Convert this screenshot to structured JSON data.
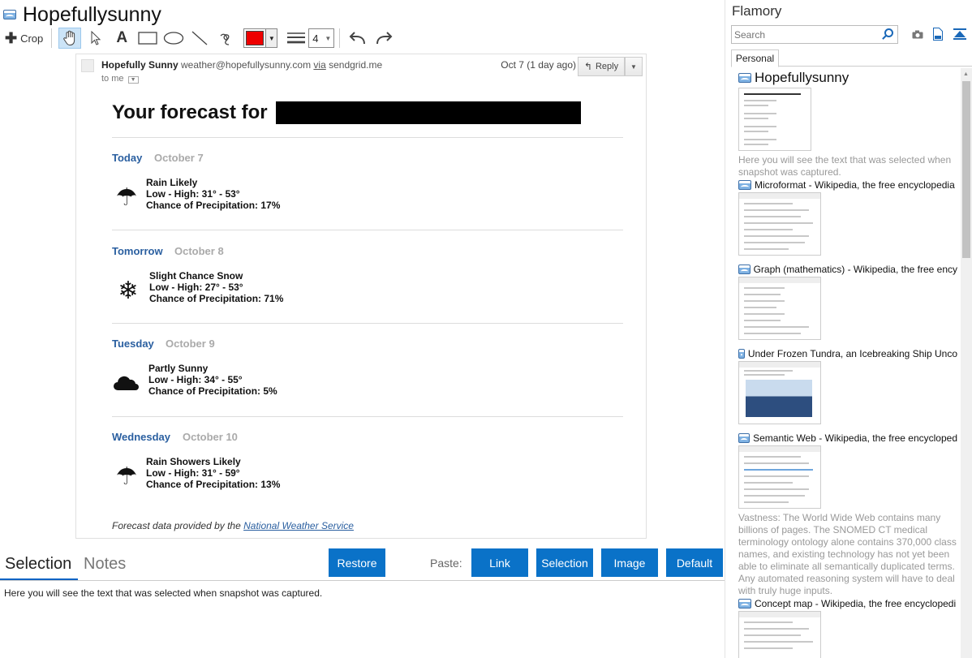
{
  "document": {
    "title": "Hopefullysunny"
  },
  "toolbar": {
    "crop_label": "Crop",
    "tools": [
      "hand-tool",
      "pointer-tool",
      "text-tool",
      "rectangle-tool",
      "ellipse-tool",
      "line-tool",
      "freehand-tool"
    ],
    "pen_color": "#ee0000",
    "line_width": "4"
  },
  "email": {
    "sender_name": "Hopefully Sunny",
    "sender_email": "weather@hopefullysunny.com",
    "via_label": "via",
    "via_domain": "sendgrid.me",
    "to_label": "to me",
    "date": "Oct 7 (1 day ago)",
    "reply_label": "Reply",
    "heading": "Your forecast for",
    "days": [
      {
        "name": "Today",
        "date": "October 7",
        "icon": "umbrella-icon",
        "condition": "Rain Likely",
        "low_high": "Low - High: 31° - 53°",
        "precip": "Chance of Precipitation: 17%"
      },
      {
        "name": "Tomorrow",
        "date": "October 8",
        "icon": "snowflake-icon",
        "condition": "Slight Chance Snow",
        "low_high": "Low - High: 27° - 53°",
        "precip": "Chance of Precipitation: 71%"
      },
      {
        "name": "Tuesday",
        "date": "October 9",
        "icon": "cloud-icon",
        "condition": "Partly Sunny",
        "low_high": "Low - High: 34° - 55°",
        "precip": "Chance of Precipitation: 5%"
      },
      {
        "name": "Wednesday",
        "date": "October 10",
        "icon": "umbrella-icon",
        "condition": "Rain Showers Likely",
        "low_high": "Low - High: 31° - 59°",
        "precip": "Chance of Precipitation: 13%"
      }
    ],
    "footer_prefix": "Forecast data provided by the",
    "footer_link": "National Weather Service"
  },
  "lower": {
    "tabs": [
      "Selection",
      "Notes"
    ],
    "restore_label": "Restore",
    "paste_label": "Paste:",
    "paste_buttons": [
      "Link",
      "Selection",
      "Image",
      "Default"
    ],
    "selection_text": "Here you will see the text that was selected when snapshot was captured."
  },
  "sidebar": {
    "app_name": "Flamory",
    "search_placeholder": "Search",
    "tab_label": "Personal",
    "snapshots": [
      {
        "title": "Hopefullysunny",
        "desc": "Here you will see the text that was selected when snapshot was captured."
      },
      {
        "title": "Microformat - Wikipedia, the free encyclopedia",
        "desc": ""
      },
      {
        "title": "Graph (mathematics) - Wikipedia, the free ency",
        "desc": ""
      },
      {
        "title": "Under Frozen Tundra, an Icebreaking Ship Unco",
        "desc": ""
      },
      {
        "title": "Semantic Web - Wikipedia, the free encycloped",
        "desc": "Vastness: The World Wide Web contains many billions of pages. The SNOMED CT medical terminology ontology alone contains 370,000 class names, and existing technology has not yet been able to eliminate all semantically duplicated terms. Any automated reasoning system will have to deal with truly huge inputs."
      },
      {
        "title": "Concept map - Wikipedia, the free encyclopedi",
        "desc": ""
      }
    ]
  }
}
